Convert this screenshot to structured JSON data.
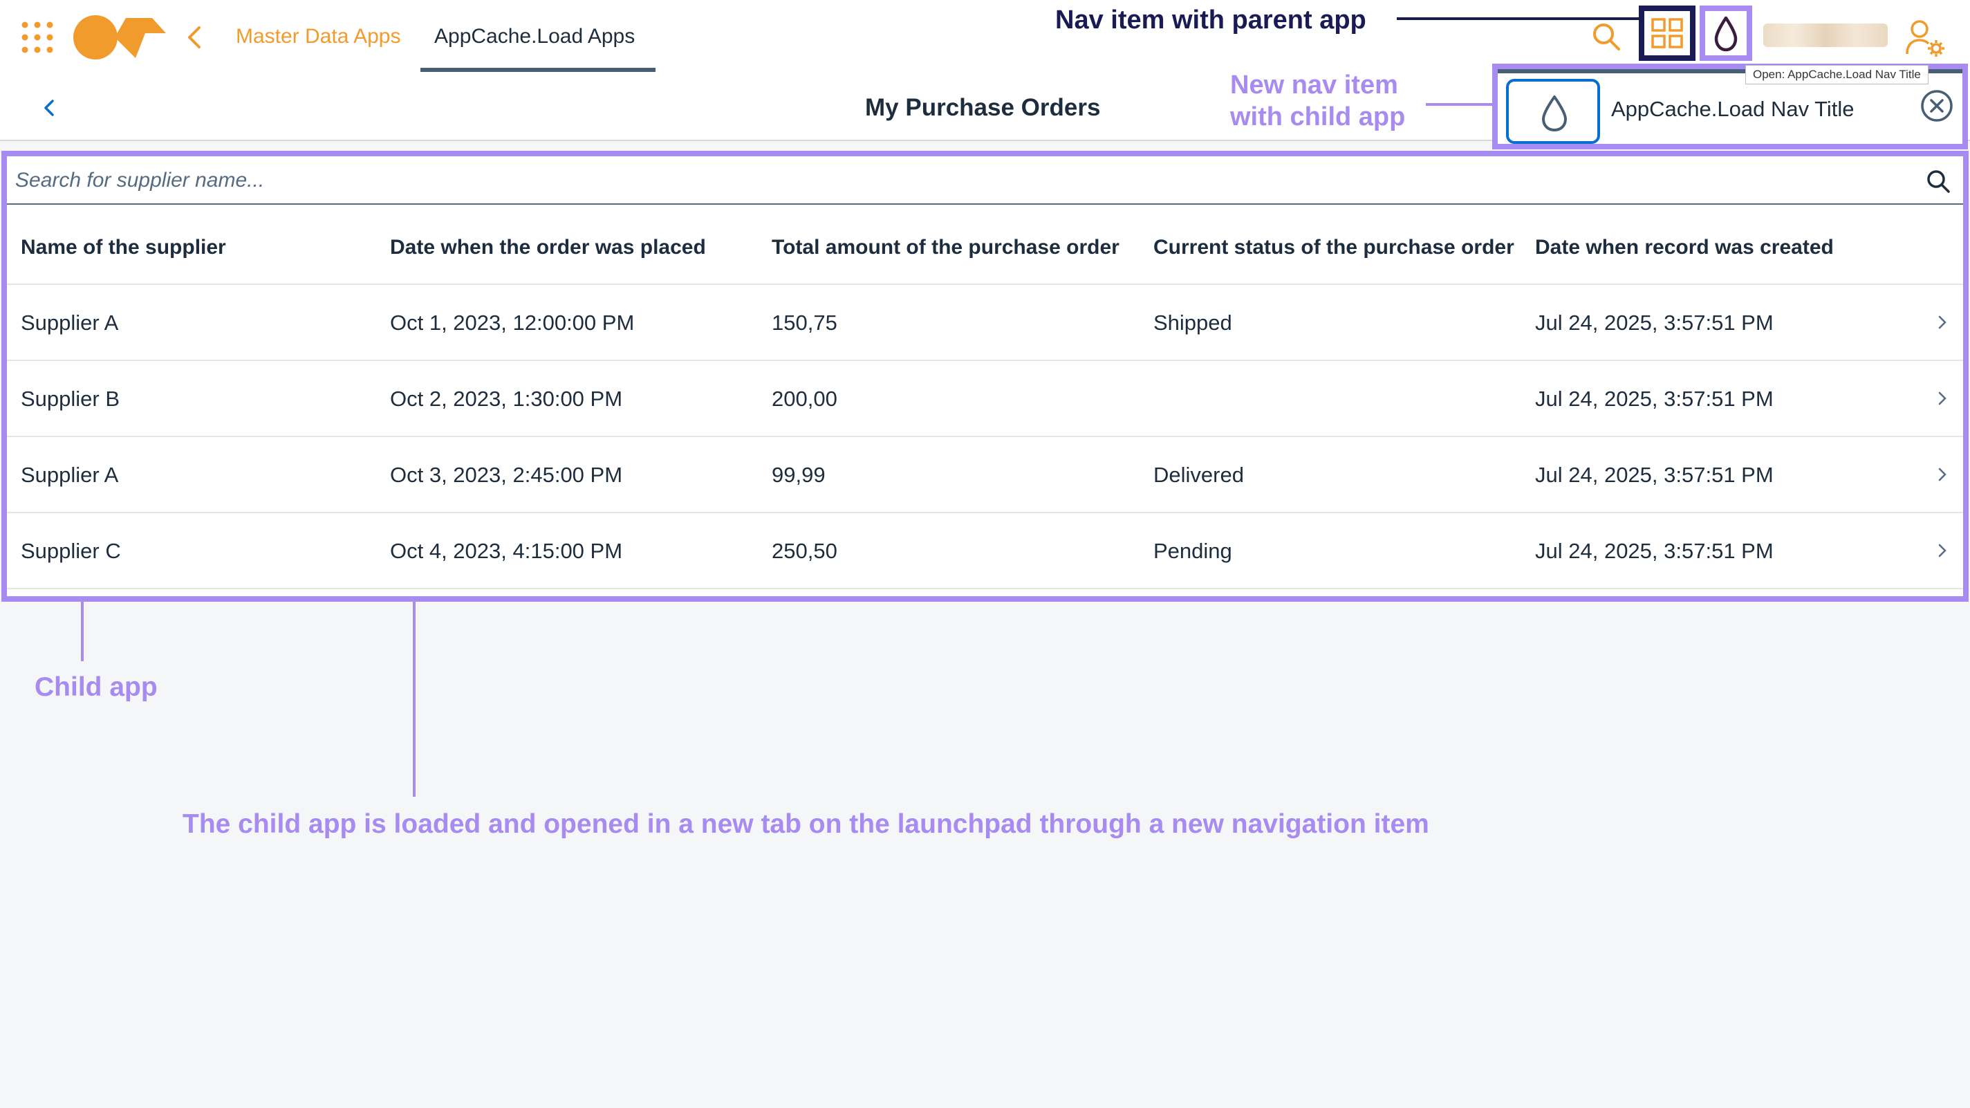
{
  "shell": {
    "breadcrumb_parent": "Master Data Apps",
    "active_tab": "AppCache.Load Apps",
    "icons": {
      "apps": "apps-grid-icon",
      "back": "chevron-left-icon",
      "search": "search-icon",
      "nav_parent": "tiles-grid-icon",
      "nav_child": "water-drop-icon",
      "user_settings": "user-settings-icon"
    },
    "accent_color": "#f29b2d"
  },
  "page": {
    "title": "My Purchase Orders"
  },
  "search": {
    "placeholder": "Search for supplier name..."
  },
  "table": {
    "columns": [
      "Name of the supplier",
      "Date when the order was placed",
      "Total amount of the purchase order",
      "Current status of the purchase order",
      "Date when record was created"
    ],
    "rows": [
      {
        "supplier": "Supplier A",
        "order_date": "Oct 1, 2023, 12:00:00 PM",
        "amount": "150,75",
        "status": "Shipped",
        "created": "Jul 24, 2025, 3:57:51 PM"
      },
      {
        "supplier": "Supplier B",
        "order_date": "Oct 2, 2023, 1:30:00 PM",
        "amount": "200,00",
        "status": "",
        "created": "Jul 24, 2025, 3:57:51 PM"
      },
      {
        "supplier": "Supplier A",
        "order_date": "Oct 3, 2023, 2:45:00 PM",
        "amount": "99,99",
        "status": "Delivered",
        "created": "Jul 24, 2025, 3:57:51 PM"
      },
      {
        "supplier": "Supplier C",
        "order_date": "Oct 4, 2023, 4:15:00 PM",
        "amount": "250,50",
        "status": "Pending",
        "created": "Jul 24, 2025, 3:57:51 PM"
      }
    ]
  },
  "popover": {
    "title": "AppCache.Load Nav Title",
    "tooltip": "Open: AppCache.Load Nav Title",
    "icon": "water-drop-icon"
  },
  "annotations": {
    "nav_parent": "Nav item with parent app",
    "new_nav_line1": "New nav item",
    "new_nav_line2": "with child app",
    "child_app": "Child app",
    "description": "The child app is loaded and opened in a new tab on the launchpad through a new navigation item",
    "highlight_color": "#a78bf0",
    "parent_highlight_color": "#1a1a54"
  }
}
